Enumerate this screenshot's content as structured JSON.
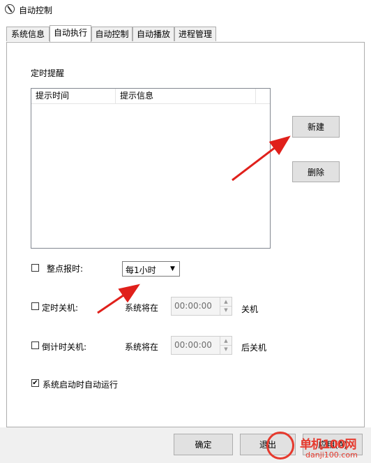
{
  "window": {
    "title": "自动控制",
    "icon": "app-clock-icon"
  },
  "tabs": [
    {
      "label": "系统信息",
      "active": false
    },
    {
      "label": "自动执行",
      "active": true
    },
    {
      "label": "自动控制",
      "active": false
    },
    {
      "label": "自动播放",
      "active": false
    },
    {
      "label": "进程管理",
      "active": false
    }
  ],
  "reminder": {
    "group_label": "定时提醒",
    "columns": [
      "提示时间",
      "提示信息"
    ],
    "new_button": "新建",
    "delete_button": "删除"
  },
  "hourly_chime": {
    "label": "整点报时:",
    "checked": false,
    "selected": "每1小时"
  },
  "timed_shutdown": {
    "label": "定时关机:",
    "checked": false,
    "prefix": "系统将在",
    "time": "00:00:00",
    "suffix": "关机"
  },
  "countdown_shutdown": {
    "label": "倒计时关机:",
    "checked": false,
    "prefix": "系统将在",
    "time": "00:00:00",
    "suffix": "后关机"
  },
  "autostart": {
    "label": "系统启动时自动运行",
    "checked": true
  },
  "footer": {
    "ok_button": "确定",
    "exit_button": "退出",
    "apply_button": "应用(A)"
  },
  "watermark": {
    "brand": "单机100网",
    "domain": "danji100.com"
  },
  "colors": {
    "arrow": "#e0201b",
    "watermark": "#e63a2e"
  }
}
